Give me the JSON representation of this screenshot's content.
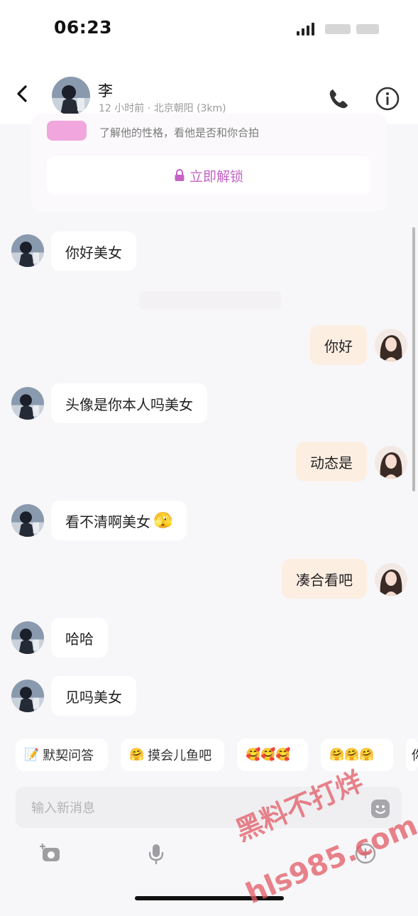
{
  "status_bar": {
    "time": "06:23"
  },
  "header": {
    "contact_name": "李",
    "contact_subtitle": "12 小时前 · 北京朝阳 (3km)",
    "icons": {
      "back": "chevron-left-icon",
      "phone": "phone-icon",
      "info": "info-icon"
    }
  },
  "unlock_card": {
    "description": "了解他的性格，看他是否和你合拍",
    "button_label": "立即解锁",
    "button_icon": "lock-icon",
    "accent_color": "#c463c4"
  },
  "messages": [
    {
      "sender": "them",
      "text": "你好美女"
    },
    {
      "sender": "me",
      "text": "你好"
    },
    {
      "sender": "them",
      "text": "头像是你本人吗美女"
    },
    {
      "sender": "me",
      "text": "动态是"
    },
    {
      "sender": "them",
      "text": "看不清啊美女",
      "emoji": "🫣"
    },
    {
      "sender": "me",
      "text": "凑合看吧"
    },
    {
      "sender": "them",
      "text": "哈哈"
    },
    {
      "sender": "them",
      "text": "见吗美女"
    }
  ],
  "quick_chips": [
    {
      "emoji": "📝",
      "label": "默契问答"
    },
    {
      "emoji": "🤗",
      "label": "摸会儿鱼吧"
    },
    {
      "emoji": "🥰🥰🥰",
      "label": ""
    },
    {
      "emoji": "🤗🤗🤗",
      "label": ""
    },
    {
      "emoji": "",
      "label": "你"
    }
  ],
  "composer": {
    "placeholder": "输入新消息",
    "icons": {
      "emoji": "smile-icon",
      "camera": "camera-icon",
      "mic": "microphone-icon",
      "plus": "plus-circle-icon"
    }
  },
  "watermark": {
    "line1": "黑料不打烊",
    "line2": "hls985.com"
  },
  "colors": {
    "outgoing_bubble": "#fdeee2",
    "incoming_bubble": "#ffffff",
    "background": "#f7f6f8"
  }
}
